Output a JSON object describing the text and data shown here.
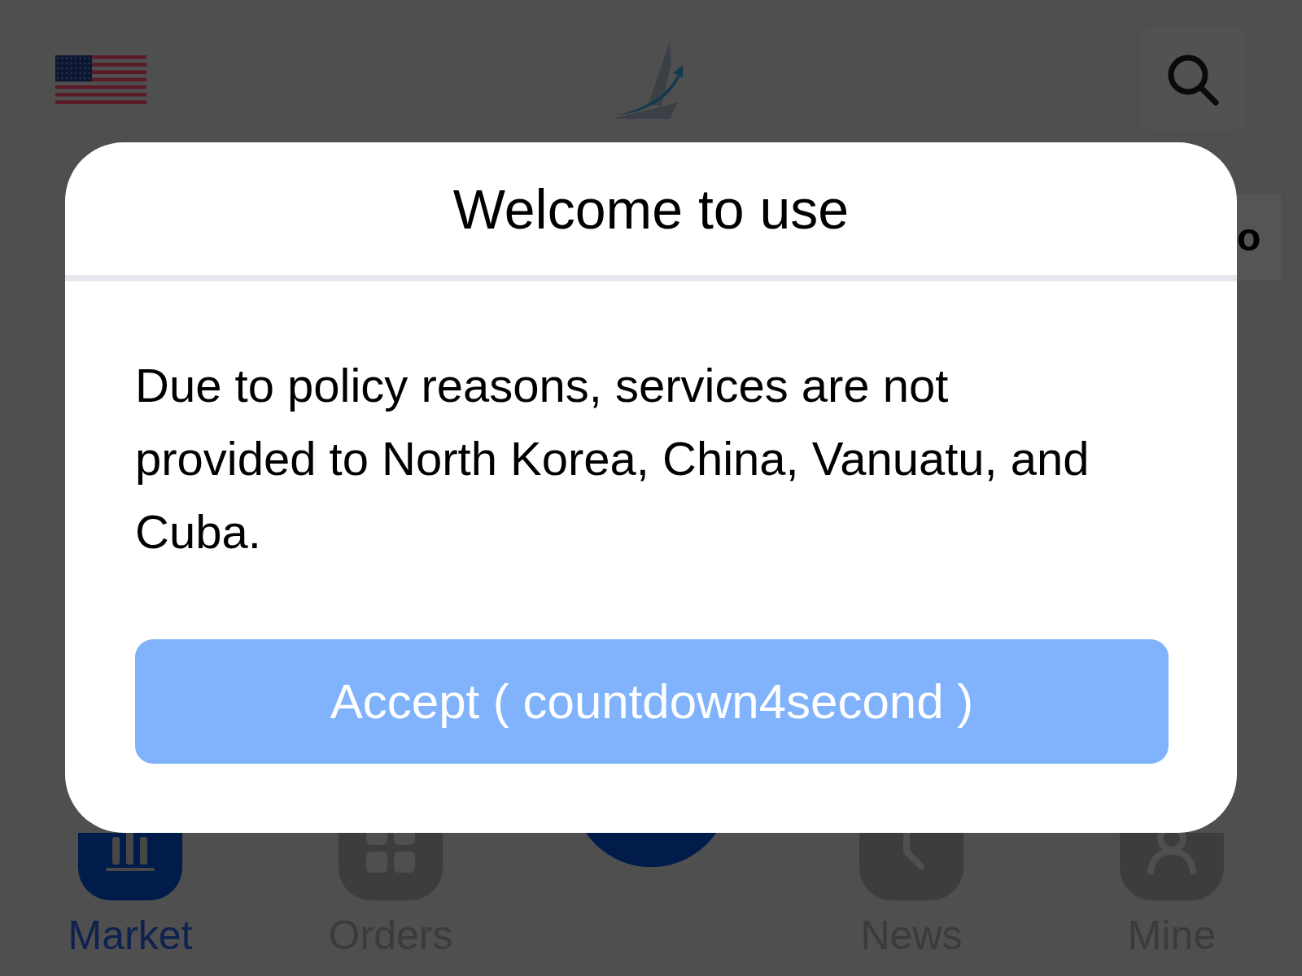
{
  "banner": {
    "text": "o"
  },
  "dialog": {
    "title": "Welcome to use",
    "message": "Due to policy reasons, services are not provided to North Korea, China, Vanuatu, and Cuba.",
    "button": "Accept ( countdown4second )"
  },
  "bottom_nav": {
    "tabs": [
      {
        "label": "Market",
        "selected": true
      },
      {
        "label": "Orders",
        "selected": false
      },
      {
        "label": "News",
        "selected": false
      },
      {
        "label": "Mine",
        "selected": false
      }
    ]
  }
}
